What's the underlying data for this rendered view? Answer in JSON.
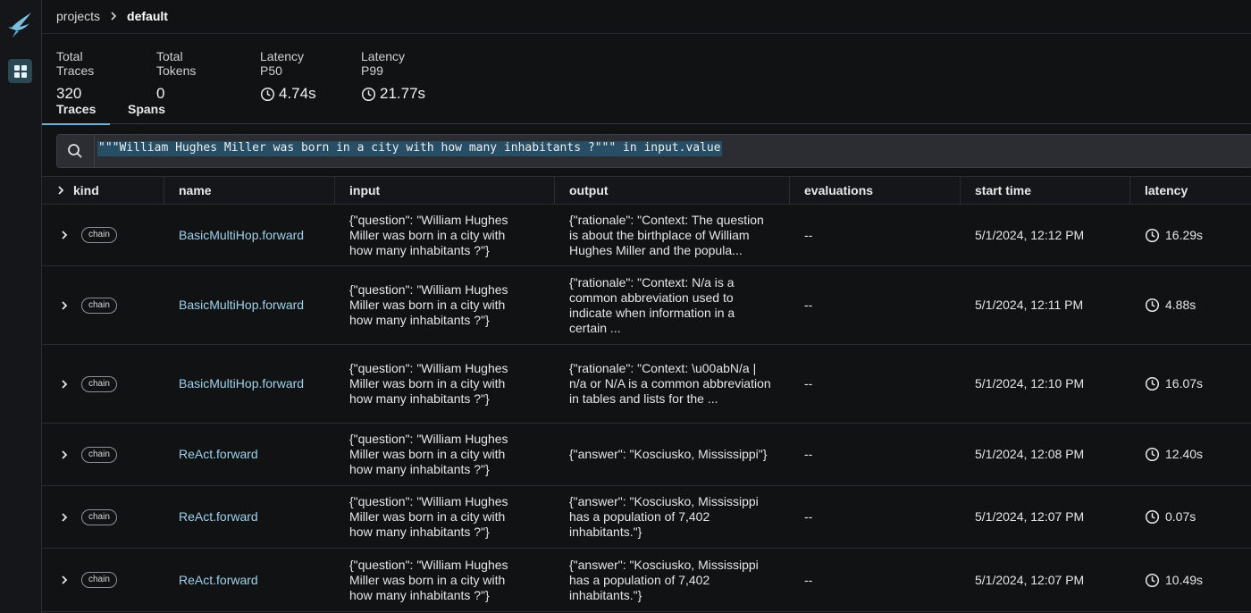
{
  "breadcrumb": {
    "parent": "projects",
    "current": "default"
  },
  "stats": [
    {
      "label": "Total Traces",
      "value": "320",
      "clock": false
    },
    {
      "label": "Total Tokens",
      "value": "0",
      "clock": false
    },
    {
      "label": "Latency P50",
      "value": "4.74s",
      "clock": true
    },
    {
      "label": "Latency P99",
      "value": "21.77s",
      "clock": true
    }
  ],
  "tabs": [
    {
      "label": "Traces",
      "active": true
    },
    {
      "label": "Spans",
      "active": false
    }
  ],
  "search": {
    "value": "\"\"\"William Hughes Miller was born in a city with how many inhabitants ?\"\"\" in input.value"
  },
  "columns": [
    "kind",
    "name",
    "input",
    "output",
    "evaluations",
    "start time",
    "latency"
  ],
  "rows": [
    {
      "kind": "chain",
      "name": "BasicMultiHop.forward",
      "input": "{\"question\": \"William Hughes Miller was born in a city with how many inhabitants ?\"}",
      "output": "{\"rationale\": \"Context: The question is about the birthplace of William Hughes Miller and the popula...",
      "evaluations": "--",
      "start_time": "5/1/2024, 12:12 PM",
      "latency": "16.29s"
    },
    {
      "kind": "chain",
      "name": "BasicMultiHop.forward",
      "input": "{\"question\": \"William Hughes Miller was born in a city with how many inhabitants ?\"}",
      "output": "{\"rationale\": \"Context: N/a is a common abbreviation used to indicate when information in a certain ...",
      "evaluations": "--",
      "start_time": "5/1/2024, 12:11 PM",
      "latency": "4.88s"
    },
    {
      "kind": "chain",
      "name": "BasicMultiHop.forward",
      "input": "{\"question\": \"William Hughes Miller was born in a city with how many inhabitants ?\"}",
      "output": "{\"rationale\": \"Context: \\u00abN/a | n/a or N/A is a common abbreviation in tables and lists for the ...",
      "evaluations": "--",
      "start_time": "5/1/2024, 12:10 PM",
      "latency": "16.07s"
    },
    {
      "kind": "chain",
      "name": "ReAct.forward",
      "input": "{\"question\": \"William Hughes Miller was born in a city with how many inhabitants ?\"}",
      "output": "{\"answer\": \"Kosciusko, Mississippi\"}",
      "evaluations": "--",
      "start_time": "5/1/2024, 12:08 PM",
      "latency": "12.40s"
    },
    {
      "kind": "chain",
      "name": "ReAct.forward",
      "input": "{\"question\": \"William Hughes Miller was born in a city with how many inhabitants ?\"}",
      "output": "{\"answer\": \"Kosciusko, Mississippi has a population of 7,402 inhabitants.\"}",
      "evaluations": "--",
      "start_time": "5/1/2024, 12:07 PM",
      "latency": "0.07s"
    },
    {
      "kind": "chain",
      "name": "ReAct.forward",
      "input": "{\"question\": \"William Hughes Miller was born in a city with how many inhabitants ?\"}",
      "output": "{\"answer\": \"Kosciusko, Mississippi has a population of 7,402 inhabitants.\"}",
      "evaluations": "--",
      "start_time": "5/1/2024, 12:07 PM",
      "latency": "10.49s"
    }
  ]
}
